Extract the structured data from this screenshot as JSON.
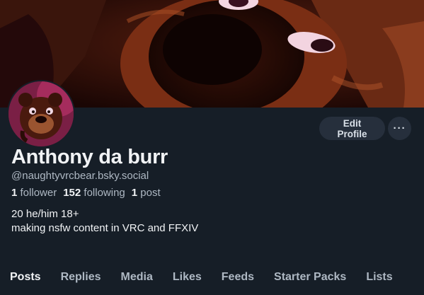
{
  "profile": {
    "display_name": "Anthony da burr",
    "handle": "@naughtyvrcbear.bsky.social",
    "followers_count": "1",
    "followers_label": "follower",
    "following_count": "152",
    "following_label": "following",
    "posts_count": "1",
    "posts_label": "post",
    "bio_line_1": "20 he/him 18+",
    "bio_line_2": "making nsfw content in VRC and FFXIV"
  },
  "actions": {
    "edit_profile_label": "Edit Profile",
    "more_label": "···"
  },
  "tabs": [
    {
      "label": "Posts",
      "active": true
    },
    {
      "label": "Replies",
      "active": false
    },
    {
      "label": "Media",
      "active": false
    },
    {
      "label": "Likes",
      "active": false
    },
    {
      "label": "Feeds",
      "active": false
    },
    {
      "label": "Starter Packs",
      "active": false
    },
    {
      "label": "Lists",
      "active": false
    }
  ],
  "colors": {
    "background": "#161e27",
    "accent": "#1083fe",
    "button_bg": "#262f3c",
    "muted_text": "#aeb8c3"
  },
  "icons": {
    "more": "ellipsis-icon"
  }
}
